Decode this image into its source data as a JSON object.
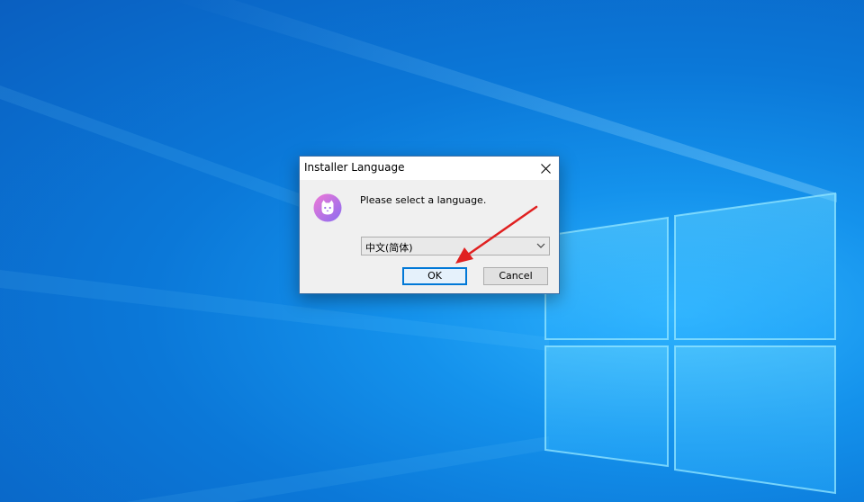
{
  "dialog": {
    "title": "Installer Language",
    "prompt": "Please select a language.",
    "language_select": {
      "selected": "中文(简体)"
    },
    "ok_label": "OK",
    "cancel_label": "Cancel"
  },
  "icons": {
    "close": "close-icon",
    "app": "cat-app-icon",
    "dropdown": "chevron-down-icon"
  },
  "colors": {
    "accent": "#0078d7",
    "annotation_arrow": "#e02020",
    "desktop": "#0b78d8"
  }
}
